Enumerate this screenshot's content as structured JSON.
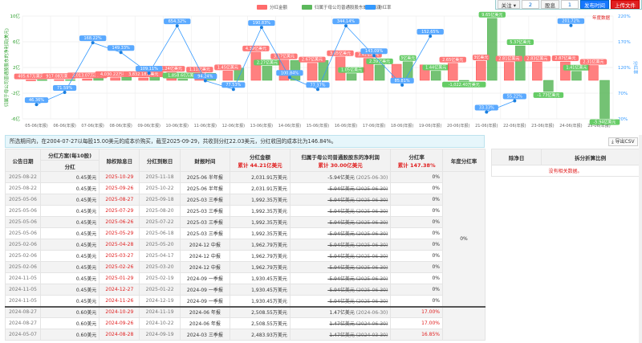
{
  "toolbar": {
    "follow": "关注 ▾",
    "follow_count": "2",
    "dividend_label": "股息",
    "dividend_count": "1",
    "publish": "发布时间",
    "upload": "上传文件"
  },
  "colors": {
    "dividend": "#ff6b6b",
    "profit": "#5cb85c",
    "rate": "#3399ff"
  },
  "chart_data": {
    "type": "bar+line",
    "legend": [
      "分红金额",
      "归属于母公司普通股股东的净利润",
      "分红率"
    ],
    "annual_label": "年度数据",
    "ylabel_left": "归属于母公司普通股股东的净利润(美元)",
    "ylabel_right": "分红率",
    "left_ticks": [
      "10亿",
      "6亿",
      "2亿",
      "-2亿",
      "-6亿"
    ],
    "right_ticks": [
      "220%",
      "170%",
      "120%",
      "70%",
      "20%"
    ],
    "ylim_left": [
      -6,
      10
    ],
    "ylim_right": [
      20,
      220
    ],
    "categories": [
      "05-06(年报)",
      "06-06(年报)",
      "07-06(年报)",
      "08-06(年报)",
      "09-06(年报)",
      "10-06(年报)",
      "11-06(年报)",
      "12-06(年报)",
      "13-06(年报)",
      "14-06(年报)",
      "15-06(年报)",
      "16-06(年报)",
      "17-06(年报)",
      "18-06(年报)",
      "19-06(年报)",
      "20-06(年报)",
      "21-06(年报)",
      "22-06(年报)",
      "23-06(年报)",
      "24-06(年报)",
      "25-06(年报)"
    ],
    "dividend": [
      0.04,
      0.09,
      0.2,
      0.4,
      0.38,
      1.24,
      1.11,
      1.45,
      4.39,
      3.17,
      2.67,
      3.65,
      3.42,
      2.5,
      2.4,
      2.65,
      3.0,
      2.81,
      2.83,
      2.87,
      2.31
    ],
    "dividend_labels": [
      "405.67万美元",
      "917.08万美元",
      "2,013.07万美元",
      "4,030.22万美元",
      "3,832.18万美元",
      "1.24亿美元",
      "1.11亿美元",
      "1.45亿美元",
      "4.39亿美元",
      "3.17亿美元",
      "2.67亿美元",
      "3.65亿美元",
      "3.42亿美元",
      "",
      "",
      "2.65亿美元",
      "3亿美元",
      "2.81亿美元",
      "2.83亿美元",
      "2.87亿美元",
      "2.31亿美元"
    ],
    "profit": [
      0.1,
      0.1,
      0.4,
      0.5,
      0.6,
      0.19,
      1.1,
      1.9,
      2.2,
      3.1,
      3.1,
      1.05,
      2.39,
      2.9,
      1.44,
      -0.1,
      9.65,
      5.37,
      -1.73,
      1.41,
      -5.94
    ],
    "profit_labels": [
      "",
      "",
      "",
      "",
      "",
      "1,858.60万美元",
      "",
      "",
      "2.27亿美元",
      "",
      "",
      "1.05亿美元",
      "2.39亿美元",
      "3亿美元",
      "1.44亿美元",
      "-1,022.40万美元",
      "9.65亿美元",
      "5.37亿美元",
      "-1.73亿美元",
      "1.41亿美元",
      "-5.94亿美元"
    ],
    "rate": [
      48,
      71.6,
      168.2,
      149.3,
      109.1,
      201,
      94.2,
      77.5,
      198,
      100.8,
      77.4,
      201,
      143.1,
      85.8,
      181,
      null,
      33.3,
      55.2,
      null,
      201.7,
      null
    ],
    "rate_labels": [
      "46.36%",
      "71.59%",
      "168.22%",
      "149.33%",
      "109.11%",
      "654.32%",
      "94.24%",
      "77.53%",
      "190.83%",
      "100.84%",
      "77.37%",
      "344.14%",
      "143.09%",
      "85.81%",
      "152.65%",
      "",
      "33.33%",
      "55.22%",
      "",
      "201.72%",
      ""
    ]
  },
  "info": "所选期间内，在2004-07-27以每股15.00美元的成本价购买，截至2025-09-29，共收到分红22.03美元，分红收回的成本比为146.84%。",
  "export": "⤓ 导出CSV",
  "table": {
    "h_date": "公告日期",
    "h_plan": "分红方案(每10股)",
    "h_plan_sub": "分红",
    "h_exdate": "除权除息日",
    "h_paydate": "分红到账日",
    "h_report": "财报时间",
    "h_amount": "分红金额",
    "h_amount_total": "累计 44.21亿美元",
    "h_profit": "归属于母公司普通股股东的净利润",
    "h_profit_total": "累计 30.00亿美元",
    "h_rate": "分红率",
    "h_rate_total": "累计 147.38%",
    "h_annual": "年度分红率",
    "annual_value": "0%",
    "rows": [
      [
        "2025-08-22",
        "0.45美元",
        "2025-10-29",
        "2025-11-18",
        "2025-06 半年报",
        "2,031.91万美元",
        "-5.94亿美元",
        "(2025-06-30)",
        "0%",
        false
      ],
      [
        "2025-08-22",
        "0.45美元",
        "2025-09-26",
        "2025-10-22",
        "2025-06 半年报",
        "2,031.91万美元",
        "-5.94亿美元",
        "(2025-06-30)",
        "0%",
        true
      ],
      [
        "2025-05-06",
        "0.45美元",
        "2025-08-27",
        "2025-09-18",
        "2025-03 三季报",
        "1,992.35万美元",
        "-5.94亿美元",
        "(2025-06-30)",
        "0%",
        true
      ],
      [
        "2025-05-06",
        "0.45美元",
        "2025-07-29",
        "2025-08-20",
        "2025-03 三季报",
        "1,992.35万美元",
        "-5.94亿美元",
        "(2025-06-30)",
        "0%",
        true
      ],
      [
        "2025-05-06",
        "0.45美元",
        "2025-06-26",
        "2025-07-22",
        "2025-03 三季报",
        "1,992.35万美元",
        "-5.94亿美元",
        "(2025-06-30)",
        "0%",
        true
      ],
      [
        "2025-05-06",
        "0.45美元",
        "2025-05-29",
        "2025-06-18",
        "2025-03 三季报",
        "1,992.35万美元",
        "-5.94亿美元",
        "(2025-06-30)",
        "0%",
        true
      ],
      [
        "2025-02-06",
        "0.45美元",
        "2025-04-28",
        "2025-05-20",
        "2024-12 中报",
        "1,962.79万美元",
        "-5.94亿美元",
        "(2025-06-30)",
        "0%",
        true
      ],
      [
        "2025-02-06",
        "0.45美元",
        "2025-03-27",
        "2025-04-17",
        "2024-12 中报",
        "1,962.79万美元",
        "-5.94亿美元",
        "(2025-06-30)",
        "0%",
        true
      ],
      [
        "2025-02-06",
        "0.45美元",
        "2025-02-26",
        "2025-03-20",
        "2024-12 中报",
        "1,962.79万美元",
        "-5.94亿美元",
        "(2025-06-30)",
        "0%",
        true
      ],
      [
        "2024-11-05",
        "0.45美元",
        "2025-01-29",
        "2025-02-19",
        "2024-09 一季报",
        "1,930.45万美元",
        "-5.94亿美元",
        "(2025-06-30)",
        "0%",
        true
      ],
      [
        "2024-11-05",
        "0.45美元",
        "2024-12-27",
        "2025-01-22",
        "2024-09 一季报",
        "1,930.45万美元",
        "-5.94亿美元",
        "(2025-06-30)",
        "0%",
        true
      ],
      [
        "2024-11-05",
        "0.45美元",
        "2024-11-26",
        "2024-12-19",
        "2024-09 一季报",
        "1,930.45万美元",
        "-5.94亿美元",
        "(2025-06-30)",
        "0%",
        true
      ],
      [
        "2024-08-27",
        "0.60美元",
        "2024-10-29",
        "2024-11-19",
        "2024-06 年报",
        "2,508.55万美元",
        "1.47亿美元",
        "(2024-06-30)",
        "17.00%",
        false
      ],
      [
        "2024-08-27",
        "0.60美元",
        "2024-09-26",
        "2024-10-22",
        "2024-06 年报",
        "2,508.55万美元",
        "1.47亿美元",
        "(2024-06-30)",
        "17.00%",
        true
      ],
      [
        "2024-05-07",
        "0.60美元",
        "2024-08-28",
        "2024-09-19",
        "2024-03 三季报",
        "2,483.93万美元",
        "1.47亿美元",
        "(2024-03-30)",
        "16.85%",
        true
      ]
    ]
  },
  "side": {
    "h_exdate": "除净日",
    "h_ratio": "拆分折算比例",
    "empty": "没有相关数据。"
  }
}
